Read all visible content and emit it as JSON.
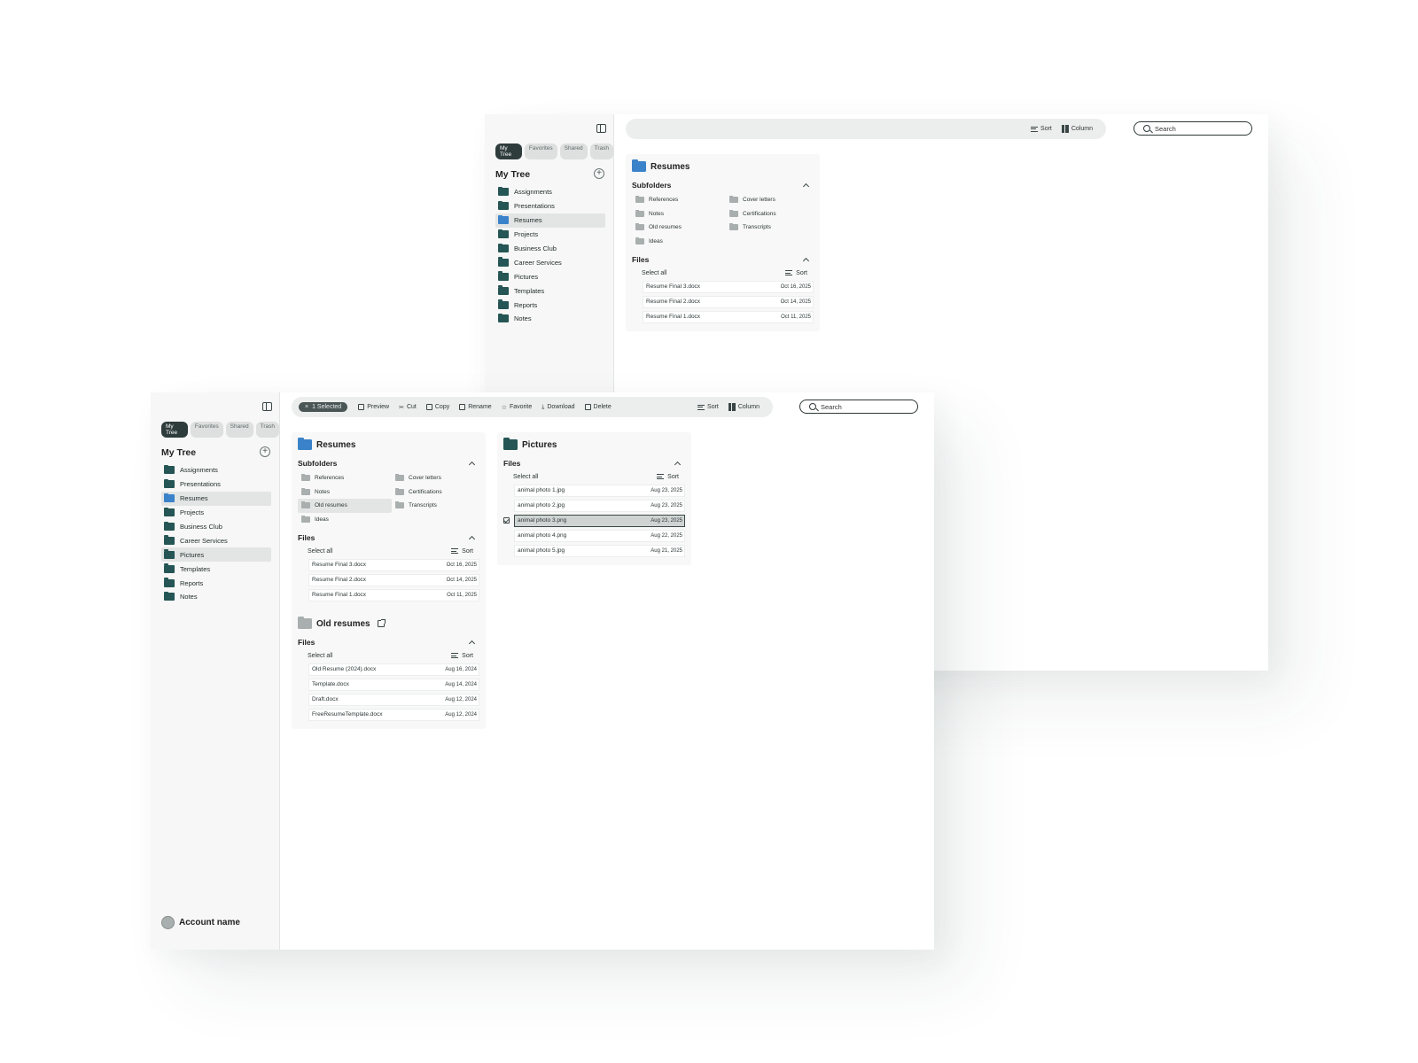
{
  "back_window": {
    "sidebar": {
      "tabs": [
        "My Tree",
        "Favorites",
        "Shared",
        "Trash"
      ],
      "title": "My Tree",
      "add_icon": "plus-circle-icon",
      "items": [
        {
          "label": "Assignments"
        },
        {
          "label": "Presentations"
        },
        {
          "label": "Resumes",
          "selected": true,
          "color": "#3a82c9"
        },
        {
          "label": "Projects"
        },
        {
          "label": "Business Club"
        },
        {
          "label": "Career Services"
        },
        {
          "label": "Pictures"
        },
        {
          "label": "Templates"
        },
        {
          "label": "Reports"
        },
        {
          "label": "Notes"
        }
      ]
    },
    "toolbar": {
      "sort": "Sort",
      "column": "Column"
    },
    "search": {
      "placeholder": "Search"
    },
    "resumes_column": {
      "title": "Resumes",
      "subfolders_title": "Subfolders",
      "subfolders": [
        "References",
        "Cover letters",
        "Notes",
        "Certifications",
        "Old resumes",
        "Transcripts",
        "Ideas"
      ],
      "files_title": "Files",
      "select_all": "Select all",
      "sort": "Sort",
      "files": [
        {
          "name": "Resume Final 3.docx",
          "date": "Oct 16, 2025"
        },
        {
          "name": "Resume Final 2.docx",
          "date": "Oct 14, 2025"
        },
        {
          "name": "Resume Final 1.docx",
          "date": "Oct 11, 2025"
        }
      ]
    }
  },
  "front_window": {
    "sidebar": {
      "tabs": [
        "My Tree",
        "Favorites",
        "Shared",
        "Trash"
      ],
      "title": "My Tree",
      "items": [
        {
          "label": "Assignments"
        },
        {
          "label": "Presentations"
        },
        {
          "label": "Resumes",
          "selected": true,
          "color": "#3a82c9"
        },
        {
          "label": "Projects"
        },
        {
          "label": "Business Club"
        },
        {
          "label": "Career Services"
        },
        {
          "label": "Pictures",
          "selected": true
        },
        {
          "label": "Templates"
        },
        {
          "label": "Reports"
        },
        {
          "label": "Notes"
        }
      ],
      "account_name": "Account name"
    },
    "toolbar": {
      "selected": "1 Selected",
      "preview": "Preview",
      "cut": "Cut",
      "copy": "Copy",
      "rename": "Rename",
      "favorite": "Favorite",
      "download": "Download",
      "delete": "Delete",
      "sort": "Sort",
      "column": "Column"
    },
    "search": {
      "placeholder": "Search"
    },
    "resumes_column": {
      "title": "Resumes",
      "subfolders_title": "Subfolders",
      "subfolders": [
        "References",
        "Cover letters",
        "Notes",
        "Certifications",
        "Old resumes",
        "Transcripts",
        "Ideas"
      ],
      "selected_subfolder": "Old resumes",
      "files_title": "Files",
      "select_all": "Select all",
      "sort": "Sort",
      "files": [
        {
          "name": "Resume Final 3.docx",
          "date": "Oct 16, 2025"
        },
        {
          "name": "Resume Final 2.docx",
          "date": "Oct 14, 2025"
        },
        {
          "name": "Resume Final 1.docx",
          "date": "Oct 11, 2025"
        }
      ],
      "old_resumes": {
        "title": "Old resumes",
        "files_title": "Files",
        "select_all": "Select all",
        "sort": "Sort",
        "files": [
          {
            "name": "Old Resume (2024).docx",
            "date": "Aug 16, 2024"
          },
          {
            "name": "Template.docx",
            "date": "Aug 14, 2024"
          },
          {
            "name": "Draft.docx",
            "date": "Aug 12, 2024"
          },
          {
            "name": "FreeResumeTemplate.docx",
            "date": "Aug 12, 2024"
          }
        ]
      }
    },
    "pictures_column": {
      "title": "Pictures",
      "files_title": "Files",
      "select_all": "Select all",
      "sort": "Sort",
      "files": [
        {
          "name": "animal photo 1.jpg",
          "date": "Aug 23, 2025"
        },
        {
          "name": "animal photo 2.jpg",
          "date": "Aug 23, 2025"
        },
        {
          "name": "animal photo 3.png",
          "date": "Aug 23, 2025",
          "selected": true
        },
        {
          "name": "animal photo 4.png",
          "date": "Aug 22, 2025"
        },
        {
          "name": "animal photo 5.jpg",
          "date": "Aug 21, 2025"
        }
      ]
    }
  },
  "colors": {
    "accent": "#255555",
    "folder_blue": "#3a82c9",
    "selected_bg": "#e2e5e4",
    "pill_bg": "#2f3c3c"
  }
}
